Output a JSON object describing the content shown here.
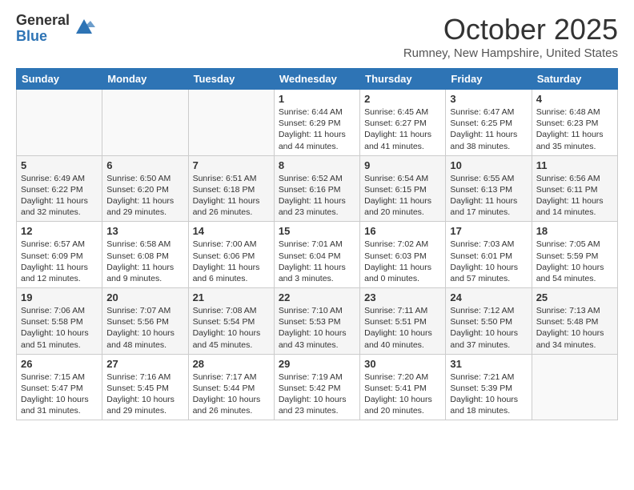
{
  "logo": {
    "general": "General",
    "blue": "Blue"
  },
  "title": "October 2025",
  "location": "Rumney, New Hampshire, United States",
  "days_of_week": [
    "Sunday",
    "Monday",
    "Tuesday",
    "Wednesday",
    "Thursday",
    "Friday",
    "Saturday"
  ],
  "weeks": [
    [
      {
        "day": "",
        "info": ""
      },
      {
        "day": "",
        "info": ""
      },
      {
        "day": "",
        "info": ""
      },
      {
        "day": "1",
        "info": "Sunrise: 6:44 AM\nSunset: 6:29 PM\nDaylight: 11 hours\nand 44 minutes."
      },
      {
        "day": "2",
        "info": "Sunrise: 6:45 AM\nSunset: 6:27 PM\nDaylight: 11 hours\nand 41 minutes."
      },
      {
        "day": "3",
        "info": "Sunrise: 6:47 AM\nSunset: 6:25 PM\nDaylight: 11 hours\nand 38 minutes."
      },
      {
        "day": "4",
        "info": "Sunrise: 6:48 AM\nSunset: 6:23 PM\nDaylight: 11 hours\nand 35 minutes."
      }
    ],
    [
      {
        "day": "5",
        "info": "Sunrise: 6:49 AM\nSunset: 6:22 PM\nDaylight: 11 hours\nand 32 minutes."
      },
      {
        "day": "6",
        "info": "Sunrise: 6:50 AM\nSunset: 6:20 PM\nDaylight: 11 hours\nand 29 minutes."
      },
      {
        "day": "7",
        "info": "Sunrise: 6:51 AM\nSunset: 6:18 PM\nDaylight: 11 hours\nand 26 minutes."
      },
      {
        "day": "8",
        "info": "Sunrise: 6:52 AM\nSunset: 6:16 PM\nDaylight: 11 hours\nand 23 minutes."
      },
      {
        "day": "9",
        "info": "Sunrise: 6:54 AM\nSunset: 6:15 PM\nDaylight: 11 hours\nand 20 minutes."
      },
      {
        "day": "10",
        "info": "Sunrise: 6:55 AM\nSunset: 6:13 PM\nDaylight: 11 hours\nand 17 minutes."
      },
      {
        "day": "11",
        "info": "Sunrise: 6:56 AM\nSunset: 6:11 PM\nDaylight: 11 hours\nand 14 minutes."
      }
    ],
    [
      {
        "day": "12",
        "info": "Sunrise: 6:57 AM\nSunset: 6:09 PM\nDaylight: 11 hours\nand 12 minutes."
      },
      {
        "day": "13",
        "info": "Sunrise: 6:58 AM\nSunset: 6:08 PM\nDaylight: 11 hours\nand 9 minutes."
      },
      {
        "day": "14",
        "info": "Sunrise: 7:00 AM\nSunset: 6:06 PM\nDaylight: 11 hours\nand 6 minutes."
      },
      {
        "day": "15",
        "info": "Sunrise: 7:01 AM\nSunset: 6:04 PM\nDaylight: 11 hours\nand 3 minutes."
      },
      {
        "day": "16",
        "info": "Sunrise: 7:02 AM\nSunset: 6:03 PM\nDaylight: 11 hours\nand 0 minutes."
      },
      {
        "day": "17",
        "info": "Sunrise: 7:03 AM\nSunset: 6:01 PM\nDaylight: 10 hours\nand 57 minutes."
      },
      {
        "day": "18",
        "info": "Sunrise: 7:05 AM\nSunset: 5:59 PM\nDaylight: 10 hours\nand 54 minutes."
      }
    ],
    [
      {
        "day": "19",
        "info": "Sunrise: 7:06 AM\nSunset: 5:58 PM\nDaylight: 10 hours\nand 51 minutes."
      },
      {
        "day": "20",
        "info": "Sunrise: 7:07 AM\nSunset: 5:56 PM\nDaylight: 10 hours\nand 48 minutes."
      },
      {
        "day": "21",
        "info": "Sunrise: 7:08 AM\nSunset: 5:54 PM\nDaylight: 10 hours\nand 45 minutes."
      },
      {
        "day": "22",
        "info": "Sunrise: 7:10 AM\nSunset: 5:53 PM\nDaylight: 10 hours\nand 43 minutes."
      },
      {
        "day": "23",
        "info": "Sunrise: 7:11 AM\nSunset: 5:51 PM\nDaylight: 10 hours\nand 40 minutes."
      },
      {
        "day": "24",
        "info": "Sunrise: 7:12 AM\nSunset: 5:50 PM\nDaylight: 10 hours\nand 37 minutes."
      },
      {
        "day": "25",
        "info": "Sunrise: 7:13 AM\nSunset: 5:48 PM\nDaylight: 10 hours\nand 34 minutes."
      }
    ],
    [
      {
        "day": "26",
        "info": "Sunrise: 7:15 AM\nSunset: 5:47 PM\nDaylight: 10 hours\nand 31 minutes."
      },
      {
        "day": "27",
        "info": "Sunrise: 7:16 AM\nSunset: 5:45 PM\nDaylight: 10 hours\nand 29 minutes."
      },
      {
        "day": "28",
        "info": "Sunrise: 7:17 AM\nSunset: 5:44 PM\nDaylight: 10 hours\nand 26 minutes."
      },
      {
        "day": "29",
        "info": "Sunrise: 7:19 AM\nSunset: 5:42 PM\nDaylight: 10 hours\nand 23 minutes."
      },
      {
        "day": "30",
        "info": "Sunrise: 7:20 AM\nSunset: 5:41 PM\nDaylight: 10 hours\nand 20 minutes."
      },
      {
        "day": "31",
        "info": "Sunrise: 7:21 AM\nSunset: 5:39 PM\nDaylight: 10 hours\nand 18 minutes."
      },
      {
        "day": "",
        "info": ""
      }
    ]
  ]
}
